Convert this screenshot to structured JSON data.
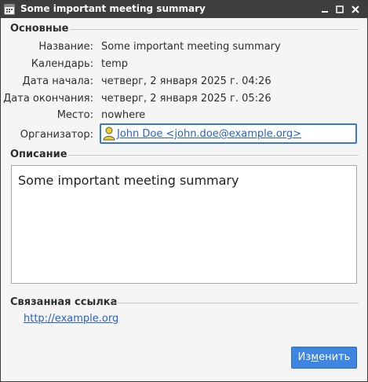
{
  "window": {
    "title": "Some important meeting summary"
  },
  "general": {
    "header": "Основные",
    "fields": [
      {
        "label": "Название:",
        "value": "Some important meeting summary"
      },
      {
        "label": "Календарь:",
        "value": "temp"
      },
      {
        "label": "Дата начала:",
        "value": "четверг, 2 января 2025 г. 04:26"
      },
      {
        "label": "Дата окончания:",
        "value": "четверг, 2 января 2025 г. 05:26"
      },
      {
        "label": "Место:",
        "value": "nowhere"
      }
    ],
    "organizer": {
      "label": "Организатор:",
      "value": "John Doe <john.doe@example.org>",
      "icon": "person-icon"
    }
  },
  "description": {
    "header": "Описание",
    "text": "Some important meeting summary"
  },
  "related_link": {
    "header": "Связанная ссылка",
    "url": "http://example.org"
  },
  "actions": {
    "edit_label_pre": "Из",
    "edit_label_mnemonic": "м",
    "edit_label_post": "енить"
  },
  "colors": {
    "titlebar": "#3e3e3e",
    "accent": "#3d85e0",
    "link": "#2a62c8"
  }
}
